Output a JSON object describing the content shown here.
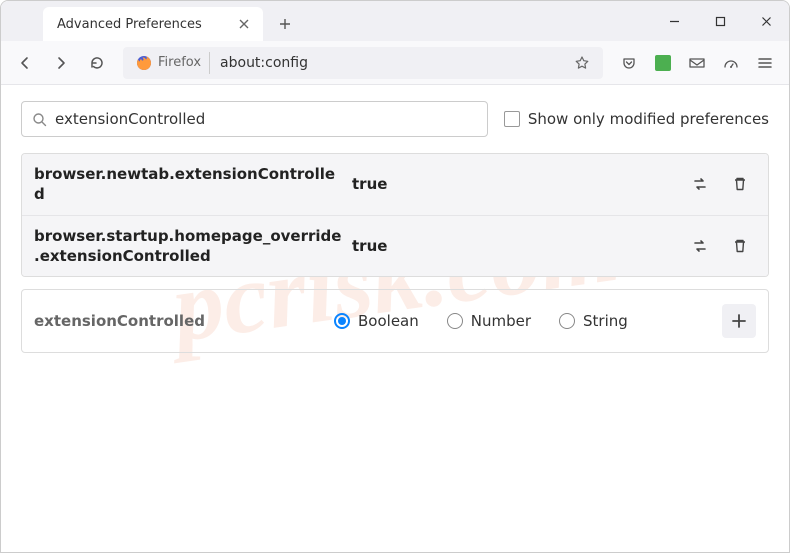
{
  "titlebar": {
    "tab_title": "Advanced Preferences"
  },
  "toolbar": {
    "identity_label": "Firefox",
    "url": "about:config"
  },
  "search": {
    "value": "extensionControlled",
    "checkbox_label": "Show only modified preferences"
  },
  "prefs": [
    {
      "name": "browser.newtab.extensionControlled",
      "value": "true"
    },
    {
      "name": "browser.startup.homepage_override.extensionControlled",
      "value": "true"
    }
  ],
  "create": {
    "name": "extensionControlled",
    "options": {
      "boolean": "Boolean",
      "number": "Number",
      "string": "String"
    }
  },
  "watermark": "pcrisk.com"
}
